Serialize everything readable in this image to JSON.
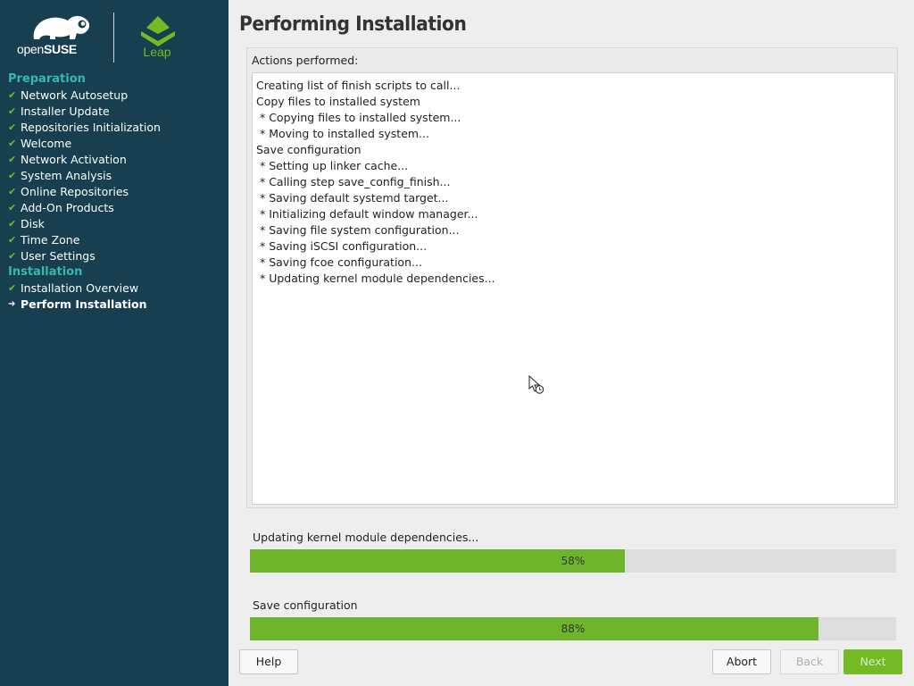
{
  "colors": {
    "sidebar_bg": "#173f4f",
    "accent_green": "#73ba25",
    "section_teal": "#35b9ab"
  },
  "branding": {
    "brand_prefix": "open",
    "brand_name": "SUSE",
    "product": "Leap"
  },
  "sidebar": {
    "sections": [
      {
        "title": "Preparation",
        "steps": [
          {
            "label": "Network Autosetup",
            "status": "done"
          },
          {
            "label": "Installer Update",
            "status": "done"
          },
          {
            "label": "Repositories Initialization",
            "status": "done"
          },
          {
            "label": "Welcome",
            "status": "done"
          },
          {
            "label": "Network Activation",
            "status": "done"
          },
          {
            "label": "System Analysis",
            "status": "done"
          },
          {
            "label": "Online Repositories",
            "status": "done"
          },
          {
            "label": "Add-On Products",
            "status": "done"
          },
          {
            "label": "Disk",
            "status": "done"
          },
          {
            "label": "Time Zone",
            "status": "done"
          },
          {
            "label": "User Settings",
            "status": "done"
          }
        ]
      },
      {
        "title": "Installation",
        "steps": [
          {
            "label": "Installation Overview",
            "status": "done"
          },
          {
            "label": "Perform Installation",
            "status": "current"
          }
        ]
      }
    ]
  },
  "main": {
    "title": "Performing Installation",
    "actions_label": "Actions performed:",
    "log": [
      "Creating list of finish scripts to call...",
      "Copy files to installed system",
      " * Copying files to installed system...",
      " * Moving to installed system...",
      "Save configuration",
      " * Setting up linker cache...",
      " * Calling step save_config_finish...",
      " * Saving default systemd target...",
      " * Initializing default window manager...",
      " * Saving file system configuration...",
      " * Saving iSCSI configuration...",
      " * Saving fcoe configuration...",
      " * Updating kernel module dependencies..."
    ],
    "progress": [
      {
        "label": "Updating kernel module dependencies...",
        "percent": 58,
        "percent_text": "58%"
      },
      {
        "label": "Save configuration",
        "percent": 88,
        "percent_text": "88%"
      }
    ]
  },
  "buttons": {
    "help": "Help",
    "abort": "Abort",
    "back": "Back",
    "next": "Next"
  }
}
